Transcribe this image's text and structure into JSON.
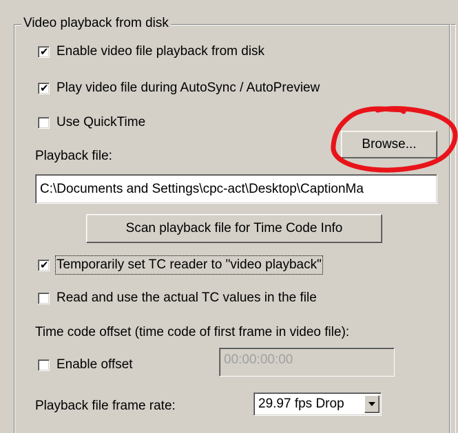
{
  "group": {
    "title": "Video playback from disk"
  },
  "options": {
    "enable_playback": {
      "label": "Enable video file playback from disk",
      "checked": true
    },
    "play_during_autosync": {
      "label": "Play video file during AutoSync / AutoPreview",
      "checked": true
    },
    "use_quicktime": {
      "label": "Use QuickTime",
      "checked": false
    },
    "temp_set_tc_reader": {
      "label": "Temporarily set TC reader to \"video playback\"",
      "checked": true
    },
    "read_actual_tc": {
      "label": "Read and use the actual TC values in the file",
      "checked": false
    },
    "enable_offset": {
      "label": "Enable offset",
      "checked": false
    }
  },
  "playback_file": {
    "label": "Playback file:",
    "browse_label": "Browse...",
    "value": "C:\\Documents and Settings\\cpc-act\\Desktop\\CaptionMa"
  },
  "scan_button": {
    "label": "Scan playback file for Time Code Info"
  },
  "offset": {
    "heading": "Time code offset (time code of first frame in video file):",
    "value": "00:00:00:00"
  },
  "frame_rate": {
    "label": "Playback file frame rate:",
    "selected": "29.97 fps Drop"
  },
  "colors": {
    "window_bg": "#d4d0c8",
    "annotation": "#e8141a"
  },
  "icons": {
    "check": "check-mark-icon",
    "dropdown": "chevron-down-icon"
  }
}
